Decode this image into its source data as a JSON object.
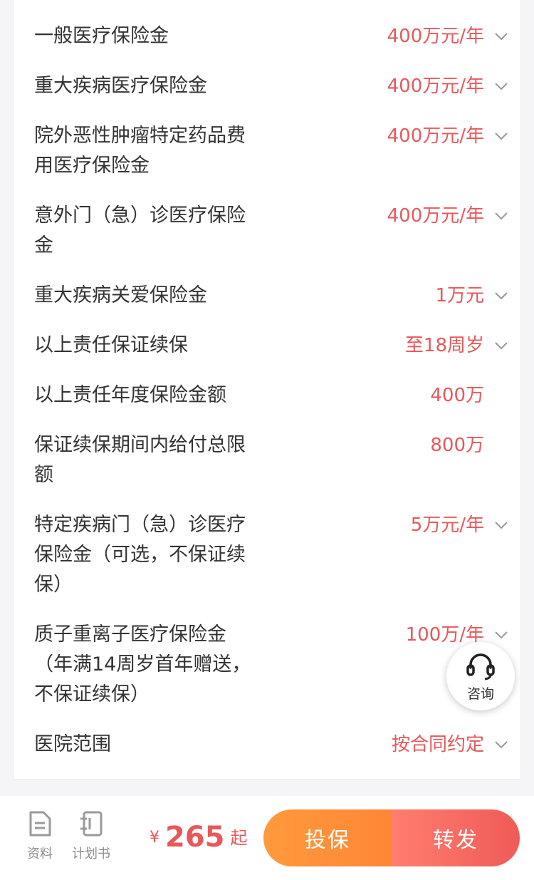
{
  "coverage": [
    {
      "label": "一般医疗保险金",
      "value": "400万元/年",
      "chevron": true
    },
    {
      "label": "重大疾病医疗保险金",
      "value": "400万元/年",
      "chevron": true
    },
    {
      "label": "院外恶性肿瘤特定药品费用医疗保险金",
      "value": "400万元/年",
      "chevron": true
    },
    {
      "label": "意外门（急）诊医疗保险金",
      "value": "400万元/年",
      "chevron": true
    },
    {
      "label": "重大疾病关爱保险金",
      "value": "1万元",
      "chevron": true
    },
    {
      "label": "以上责任保证续保",
      "value": "至18周岁",
      "chevron": true
    },
    {
      "label": "以上责任年度保险金额",
      "value": "400万",
      "chevron": false
    },
    {
      "label": "保证续保期间内给付总限额",
      "value": "800万",
      "chevron": false
    },
    {
      "label": "特定疾病门（急）诊医疗保险金（可选，不保证续保）",
      "value": "5万元/年",
      "chevron": true
    },
    {
      "label": "质子重离子医疗保险金（年满14周岁首年赠送，不保证续保）",
      "value": "100万/年",
      "chevron": true
    },
    {
      "label": "医院范围",
      "value": "按合同约定",
      "chevron": true
    }
  ],
  "consult": {
    "label": "咨询",
    "icon": "headset-icon"
  },
  "bottom_bar": {
    "tools": [
      {
        "label": "资料",
        "icon": "document-icon"
      },
      {
        "label": "计划书",
        "icon": "notebook-icon"
      }
    ],
    "price": {
      "currency": "¥",
      "amount": "265",
      "suffix": "起"
    },
    "buy_label": "投保",
    "share_label": "转发"
  },
  "colors": {
    "accent": "#e8585a",
    "buy_button": "#ff8d38",
    "share_button": "#f36a5f"
  }
}
